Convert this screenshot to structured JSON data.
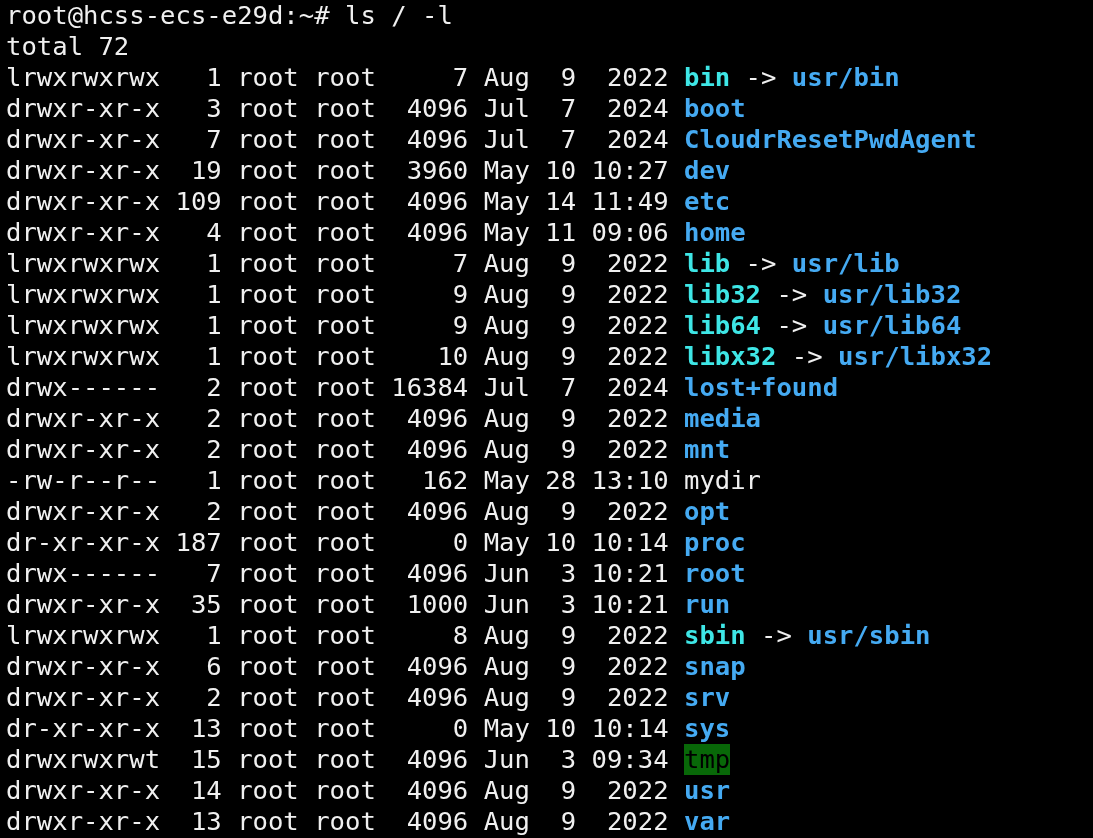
{
  "terminal": {
    "prompt": "root@hcss-ecs-e29d:~# ls / -l",
    "total": "total 72",
    "entries": [
      {
        "meta": "lrwxrwxrwx   1 root root     7 Aug  9  2022",
        "name": "bin",
        "kind": "link",
        "arrow": "->",
        "target": "usr/bin"
      },
      {
        "meta": "drwxr-xr-x   3 root root  4096 Jul  7  2024",
        "name": "boot",
        "kind": "dir"
      },
      {
        "meta": "drwxr-xr-x   7 root root  4096 Jul  7  2024",
        "name": "CloudrResetPwdAgent",
        "kind": "dir"
      },
      {
        "meta": "drwxr-xr-x  19 root root  3960 May 10 10:27",
        "name": "dev",
        "kind": "dir"
      },
      {
        "meta": "drwxr-xr-x 109 root root  4096 May 14 11:49",
        "name": "etc",
        "kind": "dir"
      },
      {
        "meta": "drwxr-xr-x   4 root root  4096 May 11 09:06",
        "name": "home",
        "kind": "dir"
      },
      {
        "meta": "lrwxrwxrwx   1 root root     7 Aug  9  2022",
        "name": "lib",
        "kind": "link",
        "arrow": "->",
        "target": "usr/lib"
      },
      {
        "meta": "lrwxrwxrwx   1 root root     9 Aug  9  2022",
        "name": "lib32",
        "kind": "link",
        "arrow": "->",
        "target": "usr/lib32"
      },
      {
        "meta": "lrwxrwxrwx   1 root root     9 Aug  9  2022",
        "name": "lib64",
        "kind": "link",
        "arrow": "->",
        "target": "usr/lib64"
      },
      {
        "meta": "lrwxrwxrwx   1 root root    10 Aug  9  2022",
        "name": "libx32",
        "kind": "link",
        "arrow": "->",
        "target": "usr/libx32"
      },
      {
        "meta": "drwx------   2 root root 16384 Jul  7  2024",
        "name": "lost+found",
        "kind": "dir"
      },
      {
        "meta": "drwxr-xr-x   2 root root  4096 Aug  9  2022",
        "name": "media",
        "kind": "dir"
      },
      {
        "meta": "drwxr-xr-x   2 root root  4096 Aug  9  2022",
        "name": "mnt",
        "kind": "dir"
      },
      {
        "meta": "-rw-r--r--   1 root root   162 May 28 13:10",
        "name": "mydir",
        "kind": "file"
      },
      {
        "meta": "drwxr-xr-x   2 root root  4096 Aug  9  2022",
        "name": "opt",
        "kind": "dir"
      },
      {
        "meta": "dr-xr-xr-x 187 root root     0 May 10 10:14",
        "name": "proc",
        "kind": "dir"
      },
      {
        "meta": "drwx------   7 root root  4096 Jun  3 10:21",
        "name": "root",
        "kind": "dir"
      },
      {
        "meta": "drwxr-xr-x  35 root root  1000 Jun  3 10:21",
        "name": "run",
        "kind": "dir"
      },
      {
        "meta": "lrwxrwxrwx   1 root root     8 Aug  9  2022",
        "name": "sbin",
        "kind": "link",
        "arrow": "->",
        "target": "usr/sbin"
      },
      {
        "meta": "drwxr-xr-x   6 root root  4096 Aug  9  2022",
        "name": "snap",
        "kind": "dir"
      },
      {
        "meta": "drwxr-xr-x   2 root root  4096 Aug  9  2022",
        "name": "srv",
        "kind": "dir"
      },
      {
        "meta": "dr-xr-xr-x  13 root root     0 May 10 10:14",
        "name": "sys",
        "kind": "dir"
      },
      {
        "meta": "drwxrwxrwt  15 root root  4096 Jun  3 09:34",
        "name": "tmp",
        "kind": "sticky"
      },
      {
        "meta": "drwxr-xr-x  14 root root  4096 Aug  9  2022",
        "name": "usr",
        "kind": "dir"
      },
      {
        "meta": "drwxr-xr-x  13 root root  4096 Aug  9  2022",
        "name": "var",
        "kind": "dir"
      }
    ]
  }
}
